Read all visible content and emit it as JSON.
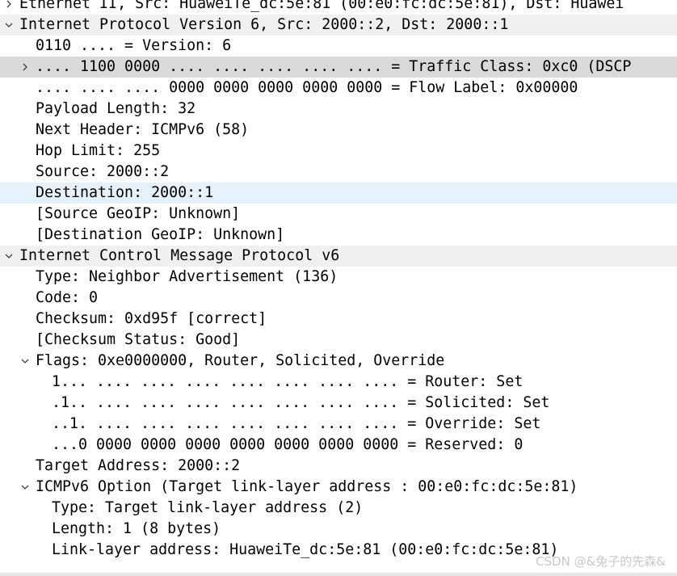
{
  "packet_tree": {
    "ethernet": "Ethernet II, Src: HuaweiTe_dc:5e:81 (00:e0:fc:dc:5e:81), Dst: Huawei",
    "ipv6": {
      "header": "Internet Protocol Version 6, Src: 2000::2, Dst: 2000::1",
      "version": "0110 .... = Version: 6",
      "traffic_class": ".... 1100 0000 .... .... .... .... .... = Traffic Class: 0xc0 (DSCP",
      "flow_label": ".... .... .... 0000 0000 0000 0000 0000 = Flow Label: 0x00000",
      "payload_length": "Payload Length: 32",
      "next_header": "Next Header: ICMPv6 (58)",
      "hop_limit": "Hop Limit: 255",
      "source": "Source: 2000::2",
      "destination": "Destination: 2000::1",
      "source_geoip": "[Source GeoIP: Unknown]",
      "destination_geoip": "[Destination GeoIP: Unknown]"
    },
    "icmpv6": {
      "header": "Internet Control Message Protocol v6",
      "type": "Type: Neighbor Advertisement (136)",
      "code": "Code: 0",
      "checksum": "Checksum: 0xd95f [correct]",
      "checksum_status": "[Checksum Status: Good]",
      "flags": {
        "header": "Flags: 0xe0000000, Router, Solicited, Override",
        "router": "1... .... .... .... .... .... .... .... = Router: Set",
        "solicited": ".1.. .... .... .... .... .... .... .... = Solicited: Set",
        "override": "..1. .... .... .... .... .... .... .... = Override: Set",
        "reserved": "...0 0000 0000 0000 0000 0000 0000 0000 = Reserved: 0"
      },
      "target_address": "Target Address: 2000::2",
      "option": {
        "header": "ICMPv6 Option (Target link-layer address : 00:e0:fc:dc:5e:81)",
        "type": "Type: Target link-layer address (2)",
        "length": "Length: 1 (8 bytes)",
        "link_layer_address": "Link-layer address: HuaweiTe_dc:5e:81 (00:e0:fc:dc:5e:81)"
      }
    }
  },
  "watermark": "CSDN @&兔子的先森&",
  "colors": {
    "selected_row": "#e5f1fb",
    "hover_row": "#dadada",
    "arrow": "#404040"
  }
}
